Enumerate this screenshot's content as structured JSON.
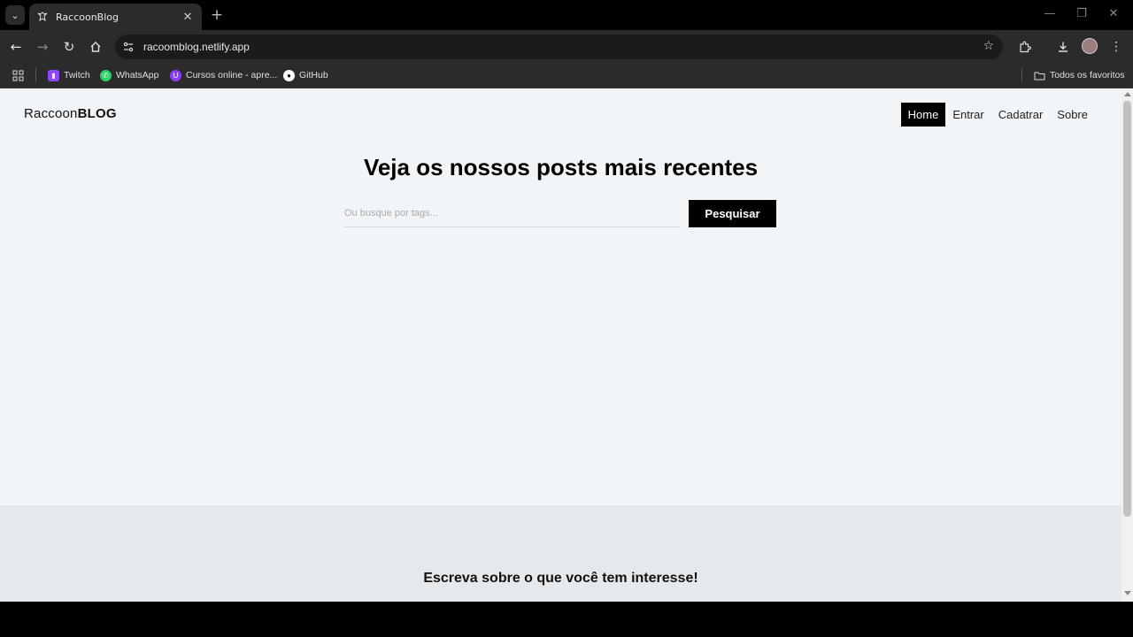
{
  "browser": {
    "tab_title": "RaccoonBlog",
    "url": "racoomblog.netlify.app",
    "bookmarks": [
      {
        "label": "Twitch",
        "icon": "twitch-icon",
        "color": "#9146ff"
      },
      {
        "label": "WhatsApp",
        "icon": "whatsapp-icon",
        "color": "#25d366"
      },
      {
        "label": "Cursos online - apre...",
        "icon": "cursos-icon",
        "color": "#8b3dff"
      },
      {
        "label": "GitHub",
        "icon": "github-icon",
        "color": "#ffffff"
      }
    ],
    "all_bookmarks_label": "Todos os favoritos"
  },
  "page": {
    "brand_light": "Raccoon",
    "brand_bold": "BLOG",
    "nav": [
      "Home",
      "Entrar",
      "Cadatrar",
      "Sobre"
    ],
    "active_nav": "Home",
    "hero_title": "Veja os nossos posts mais recentes",
    "search_placeholder": "Ou busque por tags...",
    "search_button": "Pesquisar",
    "footer_text": "Escreva sobre o que você tem interesse!"
  }
}
